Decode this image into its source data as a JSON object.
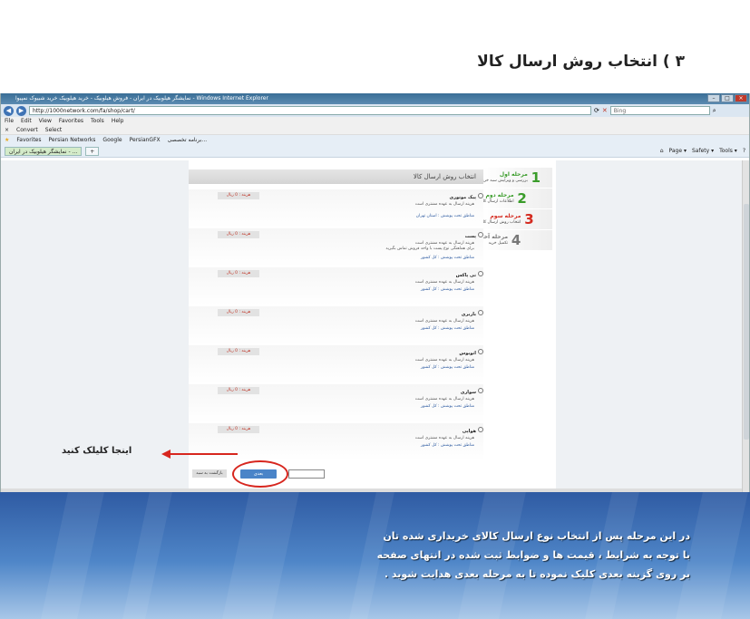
{
  "heading": "۳ ) انتخاب روش ارسال کالا",
  "browser": {
    "window_title": "نمایشگر هیلوبیک در ایران - فروش هیلوبیک - خرید هیلوبیک خرید شبیوک نمپیوا - Windows Internet Explorer",
    "url": "http://1000network.com/fa/shop/cart/",
    "search_placeholder": "Bing",
    "menu": [
      "File",
      "Edit",
      "View",
      "Favorites",
      "Tools",
      "Help"
    ],
    "command_items": [
      "Convert",
      "Select"
    ],
    "favorites": [
      "Favorites",
      "Persian Networks",
      "Google",
      "PersianGFX",
      "برنامه تخصصی..."
    ],
    "tab_label": "نمایشگر هیلوبیک در ایران - ...",
    "tab_tools": [
      "Page ▾",
      "Safety ▾",
      "Tools ▾"
    ]
  },
  "checkout": {
    "panel_title": "انتخاب روش ارسال کالا",
    "steps": [
      {
        "num": "1",
        "title": "مرحله اول",
        "sub": "بررسی و ویرایش سبد خرید"
      },
      {
        "num": "2",
        "title": "مرحله دوم",
        "sub": "اطلاعات ارسال کالا"
      },
      {
        "num": "3",
        "title": "مرحله سوم",
        "sub": "انتخاب روش ارسال کالا"
      },
      {
        "num": "4",
        "title": "مرحله آخر",
        "sub": "تکمیل خرید"
      }
    ],
    "options": [
      {
        "name": "پیک موتوری",
        "desc": "هزینه ارسال به عهده مشتری است",
        "desc2": "",
        "area": "مناطق تحت پوشش : استان تهران",
        "price": "هزینه : 0 ریال"
      },
      {
        "name": "پست",
        "desc": "هزینه ارسال به عهده مشتری است",
        "desc2": "برای هماهنگی نوع پست با واحد فروش تماس بگیرید",
        "area": "مناطق تحت پوشش : کل کشور",
        "price": "هزینه : 0 ریال"
      },
      {
        "name": "تی پاکس",
        "desc": "هزینه ارسال به عهده مشتری است",
        "desc2": "",
        "area": "مناطق تحت پوشش : کل کشور",
        "price": "هزینه : 0 ریال"
      },
      {
        "name": "باربری",
        "desc": "هزینه ارسال به عهده مشتری است",
        "desc2": "",
        "area": "مناطق تحت پوشش : کل کشور",
        "price": "هزینه : 0 ریال"
      },
      {
        "name": "اتوبوس",
        "desc": "هزینه ارسال به عهده مشتری است",
        "desc2": "",
        "area": "مناطق تحت پوشش : کل کشور",
        "price": "هزینه : 0 ریال"
      },
      {
        "name": "سواری",
        "desc": "هزینه ارسال به عهده مشتری است",
        "desc2": "",
        "area": "مناطق تحت پوشش : کل کشور",
        "price": "هزینه : 0 ریال"
      },
      {
        "name": "هواپی",
        "desc": "هزینه ارسال به عهده مشتری است",
        "desc2": "",
        "area": "مناطق تحت پوشش : کل کشور",
        "price": "هزینه : 0 ریال"
      }
    ],
    "next_label": "بعدی",
    "back_label": "بازگشت به سبد"
  },
  "annotation": {
    "hint": "اینجا کلیلک کنید",
    "arrow_color": "#d7261e"
  },
  "instructions": [
    "در این مرحله پس از انتخاب نوع ارسال کالای خریداری شده تان",
    "با توجه به شرایط ، قیمت ها و ضوابط ثبت شده در انتهای صفحه",
    "بر روی گزینه بعدی کلیک نموده تا به مرحله بعدی هدایت شوید ."
  ],
  "colors": {
    "step_green": "#3a9c2a",
    "step_red": "#d42a1f",
    "next_button": "#4a84c8",
    "band": "#2f5ba3"
  }
}
